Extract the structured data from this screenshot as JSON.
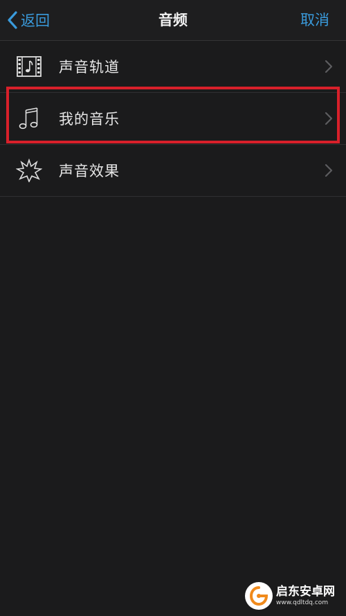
{
  "navbar": {
    "back_label": "返回",
    "title": "音频",
    "cancel_label": "取消"
  },
  "list": {
    "items": [
      {
        "label": "声音轨道",
        "icon": "film-music-icon"
      },
      {
        "label": "我的音乐",
        "icon": "music-note-icon",
        "highlighted": true
      },
      {
        "label": "声音效果",
        "icon": "starburst-icon"
      }
    ]
  },
  "watermark": {
    "title": "启东安卓网",
    "url": "www.qdltdq.com"
  },
  "colors": {
    "accent": "#3a9bdc",
    "background": "#1b1b1c",
    "highlight": "#d8202a"
  }
}
